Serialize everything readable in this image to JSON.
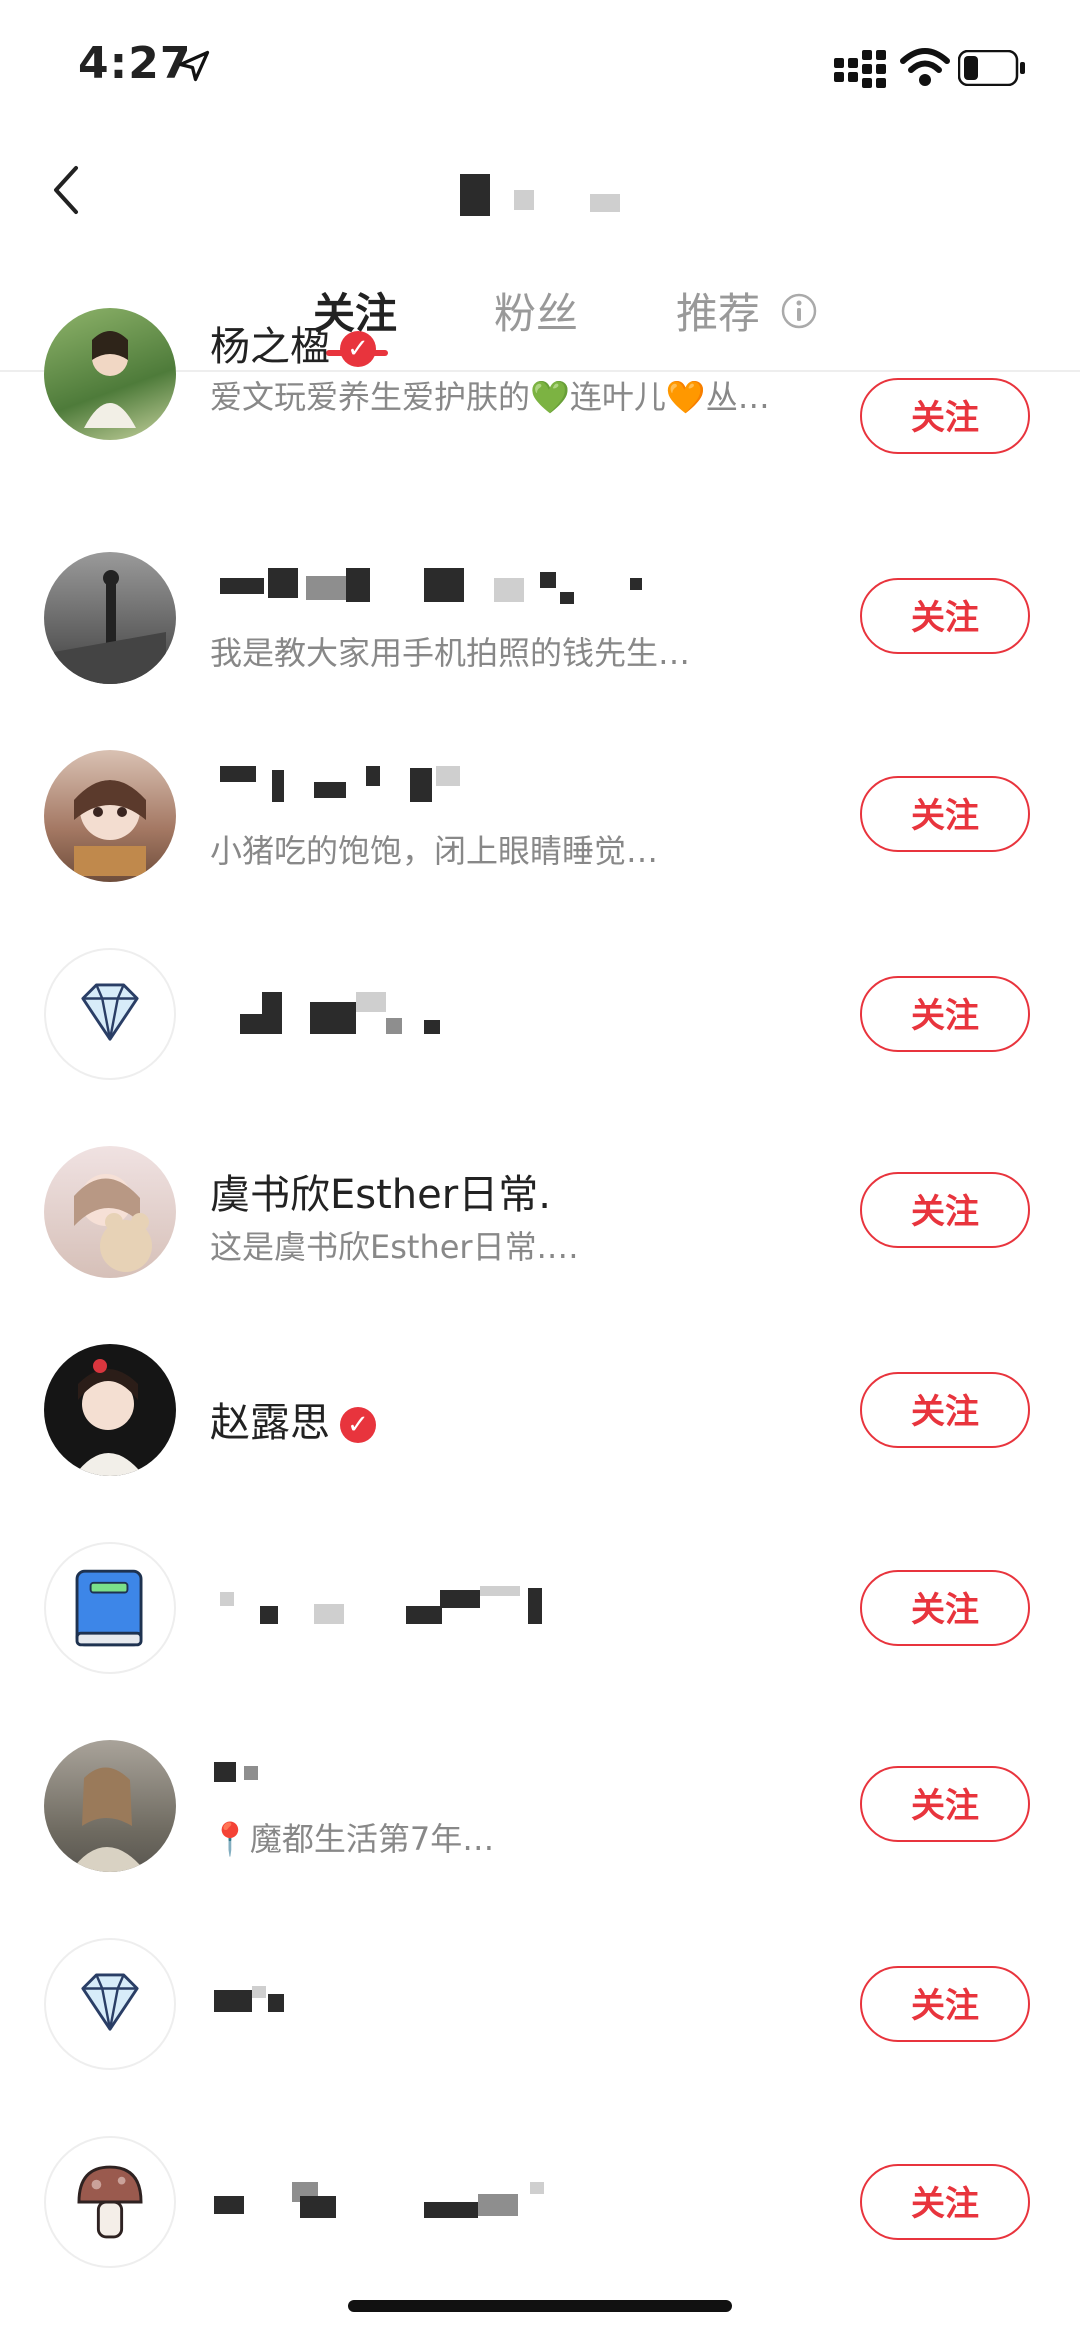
{
  "status": {
    "time": "4:27"
  },
  "header": {
    "title": ""
  },
  "tabs": [
    {
      "label": "关注"
    },
    {
      "label": "粉丝"
    },
    {
      "label": "推荐"
    }
  ],
  "list": [
    {
      "name": "杨之楹",
      "verified": true,
      "desc": "爱文玩爱养生爱护肤的💚连叶儿🧡丛…",
      "button": "关注"
    },
    {
      "name": "",
      "verified": false,
      "desc": "我是教大家用手机拍照的钱先生…",
      "button": "关注"
    },
    {
      "name": "",
      "verified": false,
      "desc": "小猪吃的饱饱，闭上眼睛睡觉…",
      "button": "关注"
    },
    {
      "name": "",
      "verified": false,
      "desc": "",
      "button": "关注"
    },
    {
      "name": "虞书欣Esther日常.",
      "verified": false,
      "desc": "这是虞书欣Esther日常.…",
      "button": "关注"
    },
    {
      "name": "赵露思",
      "verified": true,
      "desc": "",
      "button": "关注"
    },
    {
      "name": "",
      "verified": false,
      "desc": "",
      "button": "关注"
    },
    {
      "name": "",
      "verified": false,
      "desc": "📍魔都生活第7年…",
      "button": "关注"
    },
    {
      "name": "",
      "verified": false,
      "desc": "",
      "button": "关注"
    },
    {
      "name": "",
      "verified": false,
      "desc": "",
      "button": "关注"
    }
  ],
  "colors": {
    "accent": "#e8343d"
  },
  "icons": [
    "back-arrow-icon",
    "info-icon",
    "verified-icon",
    "diamond-icon",
    "book-icon",
    "mushroom-icon",
    "location-icon"
  ]
}
